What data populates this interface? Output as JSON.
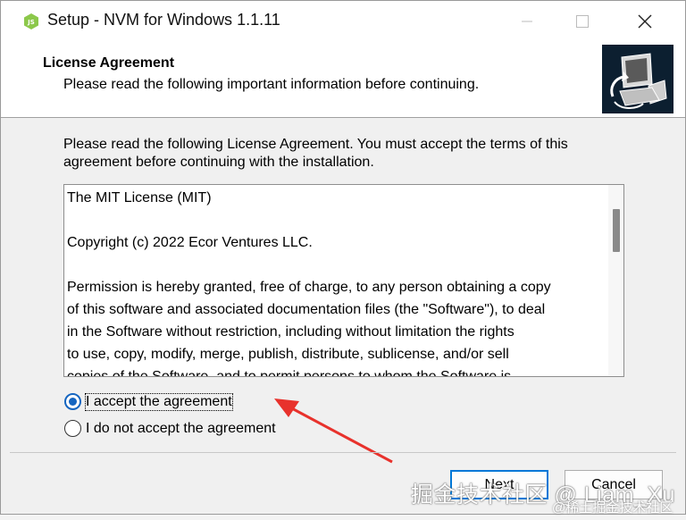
{
  "window": {
    "title": "Setup - NVM for Windows 1.1.11"
  },
  "header": {
    "title": "License Agreement",
    "subtitle": "Please read the following important information before continuing."
  },
  "main": {
    "intro": "Please read the following License Agreement. You must accept the terms of this agreement before continuing with the installation.",
    "license_text": "The MIT License (MIT)\n\nCopyright (c) 2022 Ecor Ventures LLC.\n\nPermission is hereby granted, free of charge, to any person obtaining a copy\nof this software and associated documentation files (the \"Software\"), to deal\nin the Software without restriction, including without limitation the rights\nto use, copy, modify, merge, publish, distribute, sublicense, and/or sell\ncopies of the Software, and to permit persons to whom the Software is",
    "scroll_position": 0.12,
    "options": {
      "accept": "I accept the agreement",
      "decline": "I do not accept the agreement",
      "selected": "accept"
    }
  },
  "buttons": {
    "next": "Next",
    "cancel": "Cancel"
  },
  "annotation": {
    "arrow_color": "#e8322c"
  },
  "watermark": {
    "main": "掘金技术社区 @ Liam_Xu",
    "sub": "@稀土掘金技术社区"
  }
}
